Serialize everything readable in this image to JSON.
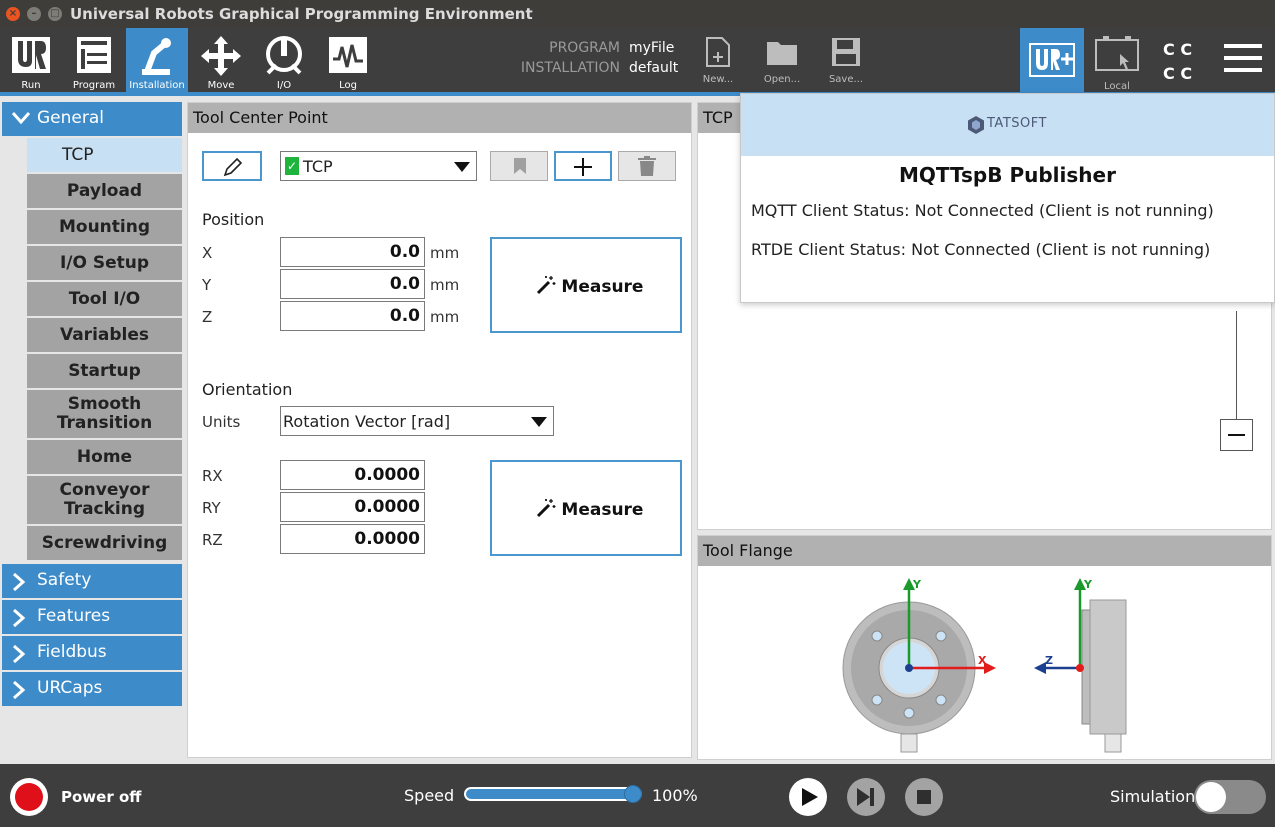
{
  "window": {
    "title": "Universal Robots Graphical Programming Environment"
  },
  "toolbar": {
    "tabs": [
      {
        "label": "Run",
        "icon": "ur-logo-icon"
      },
      {
        "label": "Program",
        "icon": "program-icon"
      },
      {
        "label": "Installation",
        "icon": "installation-icon"
      },
      {
        "label": "Move",
        "icon": "move-icon"
      },
      {
        "label": "I/O",
        "icon": "io-icon"
      },
      {
        "label": "Log",
        "icon": "log-icon"
      }
    ],
    "program_label": "PROGRAM",
    "program_value": "myFile",
    "installation_label": "INSTALLATION",
    "installation_value": "default",
    "file_buttons": [
      {
        "label": "New...",
        "icon": "new-file-icon"
      },
      {
        "label": "Open...",
        "icon": "open-folder-icon"
      },
      {
        "label": "Save...",
        "icon": "save-icon"
      }
    ],
    "local_label": "Local",
    "cc_text": [
      "C C",
      "C C"
    ]
  },
  "nav": {
    "categories": [
      "General",
      "Safety",
      "Features",
      "Fieldbus",
      "URCaps"
    ],
    "general_items": [
      "TCP",
      "Payload",
      "Mounting",
      "I/O Setup",
      "Tool I/O",
      "Variables",
      "Startup",
      "Smooth Transition",
      "Home",
      "Conveyor Tracking",
      "Screwdriving"
    ],
    "selected": "TCP"
  },
  "tcp_panel": {
    "title": "Tool Center Point",
    "tcp_select": "TCP",
    "position_title": "Position",
    "position": [
      {
        "axis": "X",
        "value": "0.0",
        "unit": "mm"
      },
      {
        "axis": "Y",
        "value": "0.0",
        "unit": "mm"
      },
      {
        "axis": "Z",
        "value": "0.0",
        "unit": "mm"
      }
    ],
    "measure_label": "Measure",
    "orientation_title": "Orientation",
    "units_label": "Units",
    "units_value": "Rotation Vector [rad]",
    "rotation": [
      {
        "axis": "RX",
        "value": "0.0000"
      },
      {
        "axis": "RY",
        "value": "0.0000"
      },
      {
        "axis": "RZ",
        "value": "0.0000"
      }
    ]
  },
  "right_panel": {
    "title": "TCP",
    "tool_flange_title": "Tool Flange",
    "flange_labels": {
      "y": "Y",
      "x": "X",
      "y2": "Y",
      "z": "Z"
    }
  },
  "popup": {
    "brand": "TATSOFT",
    "title": "MQTTspB Publisher",
    "mqtt_status": "MQTT Client Status: Not Connected (Client is not running)",
    "rtde_status": "RTDE Client Status: Not Connected (Client is not running)"
  },
  "bottom": {
    "power_label": "Power off",
    "speed_label": "Speed",
    "speed_value": "100%",
    "speed_fraction": 1.0,
    "simulation_label": "Simulation"
  },
  "colors": {
    "accent": "#3d8bc9",
    "selected_bg": "#c8e0f3",
    "power_red": "#e0101a",
    "tcp_green": "#1fb53c"
  }
}
